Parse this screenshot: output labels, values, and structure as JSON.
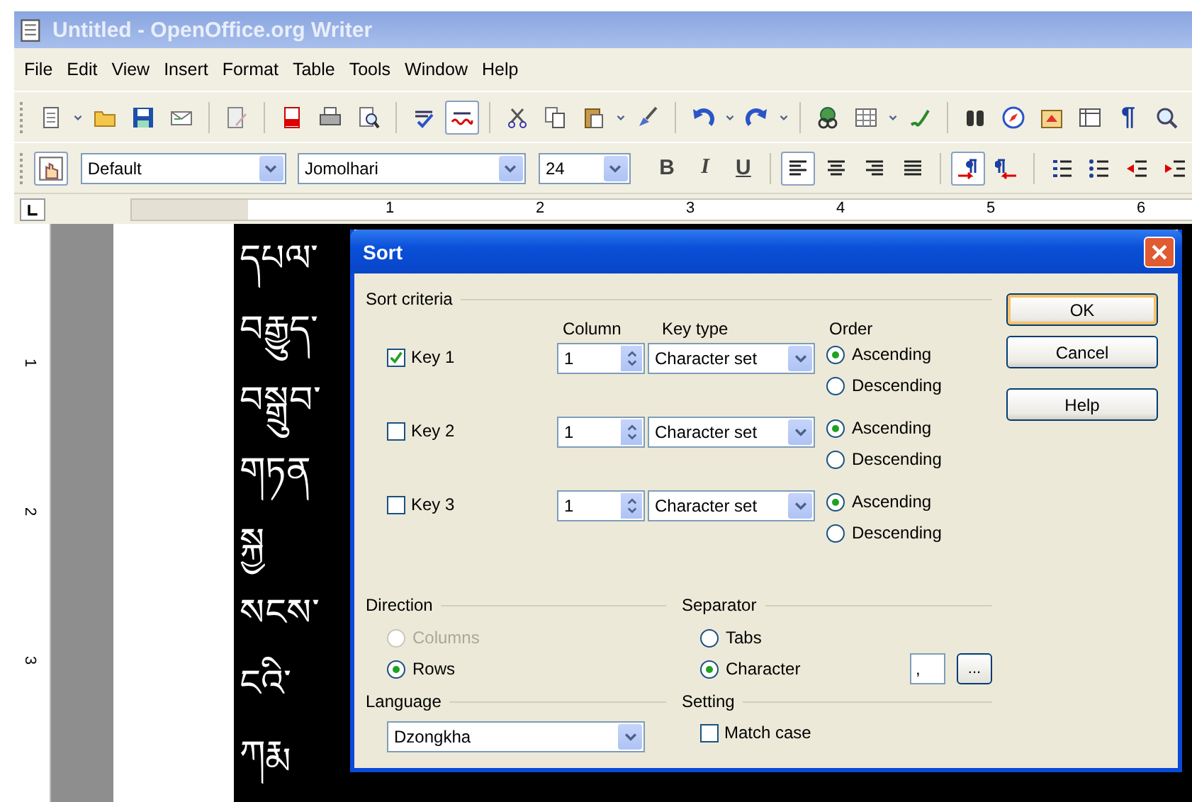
{
  "window": {
    "title": "Untitled - OpenOffice.org Writer"
  },
  "menu": [
    "File",
    "Edit",
    "View",
    "Insert",
    "Format",
    "Table",
    "Tools",
    "Window",
    "Help"
  ],
  "standard_toolbar": {
    "autospellcheck_on": true,
    "pilcrow": "¶"
  },
  "formatting_toolbar": {
    "style": "Default",
    "font": "Jomolhari",
    "size": "24",
    "bold": "B",
    "italic": "I",
    "underline": "U",
    "alignment_buttons": [
      {
        "selected": true
      },
      {
        "selected": false
      },
      {
        "selected": false
      },
      {
        "selected": false
      }
    ],
    "direction_buttons": [
      {
        "selected": true
      },
      {
        "selected": false
      }
    ]
  },
  "ruler": {
    "numbers": [
      "1",
      "2",
      "3",
      "4",
      "5",
      "6"
    ]
  },
  "vertical_ruler": {
    "numbers": [
      "1",
      "2",
      "3"
    ]
  },
  "document": {
    "lines": [
      "དཔལ་",
      "བརྒྱུད་",
      "བསྒྲུབ་",
      "གཏན",
      "སྐྱ",
      "སངས་",
      "ངའི་",
      "ཀརྨ"
    ]
  },
  "dialog": {
    "title": "Sort",
    "criteria_label": "Sort criteria",
    "column_header": "Column",
    "key_type_header": "Key type",
    "order_header": "Order",
    "keys": [
      {
        "label": "Key 1",
        "checked": true,
        "column": "1",
        "key_type": "Character set",
        "orders": [
          {
            "label": "Ascending",
            "selected": true
          },
          {
            "label": "Descending",
            "selected": false
          }
        ]
      },
      {
        "label": "Key 2",
        "checked": false,
        "column": "1",
        "key_type": "Character set",
        "orders": [
          {
            "label": "Ascending",
            "selected": true
          },
          {
            "label": "Descending",
            "selected": false
          }
        ]
      },
      {
        "label": "Key 3",
        "checked": false,
        "column": "1",
        "key_type": "Character set",
        "orders": [
          {
            "label": "Ascending",
            "selected": true
          },
          {
            "label": "Descending",
            "selected": false
          }
        ]
      }
    ],
    "direction": {
      "label": "Direction",
      "options": [
        {
          "label": "Columns",
          "selected": false,
          "disabled": true
        },
        {
          "label": "Rows",
          "selected": true,
          "disabled": false
        }
      ]
    },
    "language": {
      "label": "Language",
      "value": "Dzongkha"
    },
    "separator": {
      "label": "Separator",
      "options": [
        {
          "label": "Tabs",
          "selected": false
        },
        {
          "label": "Character",
          "selected": true
        }
      ],
      "character": ",",
      "browse": "..."
    },
    "setting": {
      "label": "Setting",
      "match_case": {
        "label": "Match case",
        "checked": false
      }
    },
    "buttons": [
      {
        "label": "OK",
        "default": true
      },
      {
        "label": "Cancel",
        "default": false
      },
      {
        "label": "Help",
        "default": false
      }
    ]
  }
}
